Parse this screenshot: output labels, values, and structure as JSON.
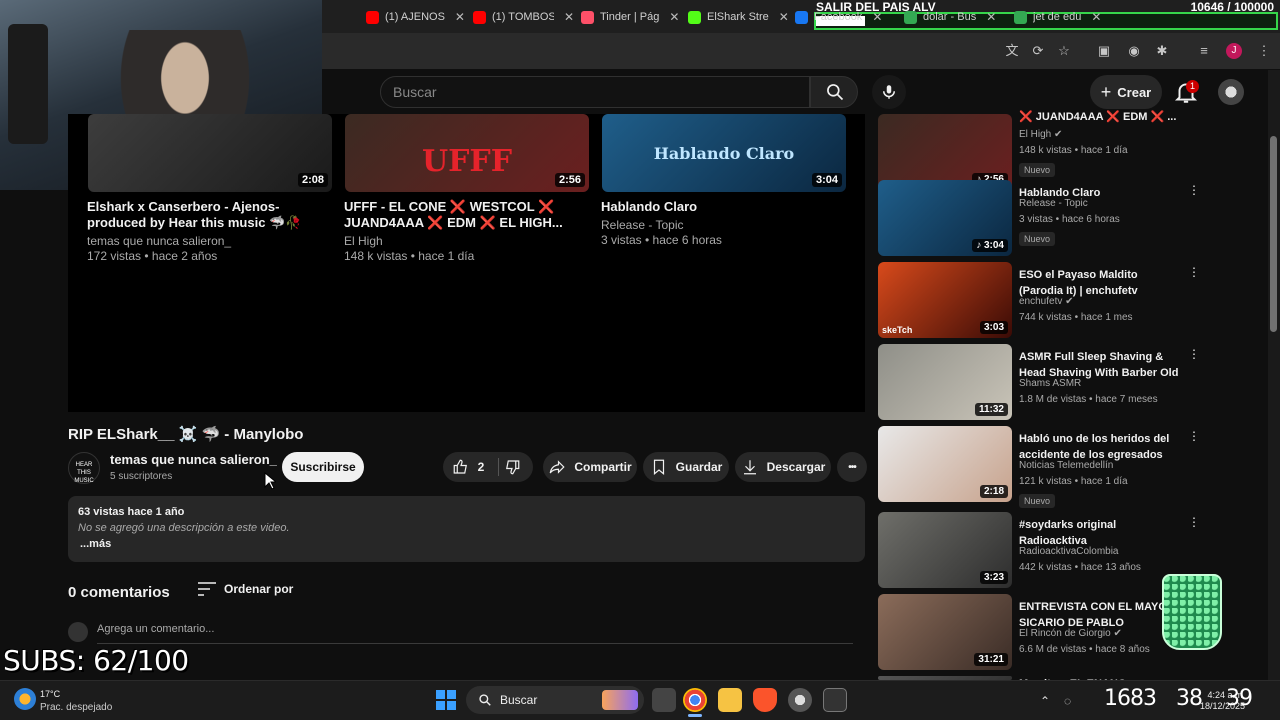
{
  "browser": {
    "tabs": [
      {
        "title": "(1) AJENOS",
        "color": "#ff0000"
      },
      {
        "title": "(1) TOMBOS",
        "color": "#ff0000"
      },
      {
        "title": "Tinder | Pág",
        "color": "#fd5068"
      },
      {
        "title": "ElShark Stre",
        "color": "#53fc18"
      },
      {
        "title": "Facebook",
        "color": "#1877f2"
      },
      {
        "title": "dolar - Bus",
        "color": "#34a853"
      },
      {
        "title": "jet de edu",
        "color": "#34a853"
      }
    ],
    "profile_initial": "J"
  },
  "stream_overlay": {
    "goal_title": "SALIR DEL PAIS ALV",
    "goal_count": "10646 / 100000",
    "goal_progress": 0.106,
    "subs_goal": "SUBS: 62/100"
  },
  "youtube_header": {
    "search_placeholder": "Buscar",
    "create_label": "Crear",
    "notification_count": "1"
  },
  "end_screen": [
    {
      "title": "Elshark x Canserbero - Ajenos- produced by Hear this music 🦈🥀",
      "channel": "temas que nunca salieron_",
      "meta": "172 vistas • hace 2 años",
      "duration": "2:08",
      "colors": [
        "#3d3d3d",
        "#1a1a1a"
      ]
    },
    {
      "title": "UFFF - EL CONE ❌ WESTCOL ❌ JUAND4AAA ❌ EDM ❌ EL HIGH...",
      "channel": "El High",
      "meta": "148 k vistas • hace 1 día",
      "duration": "2:56",
      "thumb_text": "UFFF",
      "colors": [
        "#3b2a22",
        "#6b1f1f"
      ]
    },
    {
      "title": "Hablando Claro",
      "channel": "Release - Topic",
      "meta": "3 vistas • hace 6 horas",
      "duration": "3:04",
      "thumb_text": "Hablando Claro",
      "colors": [
        "#1f5e8a",
        "#0b2740"
      ]
    }
  ],
  "video": {
    "title": "RIP ELShark__ ☠️ 🦈 - Manylobo",
    "channel_name": "temas que nunca salieron_",
    "channel_avatar_text": "HEAR THIS MUSIC",
    "subscribers": "5 suscriptores",
    "subscribe_label": "Suscribirse",
    "likes": "2",
    "share_label": "Compartir",
    "save_label": "Guardar",
    "download_label": "Descargar",
    "more_label": "•••",
    "views_date": "63 vistas  hace 1 año",
    "description": "No se agregó una descripción a este video.",
    "more_link": "...más"
  },
  "comments": {
    "count_label": "0 comentarios",
    "sort_label": "Ordenar por",
    "input_placeholder": "Agrega un comentario..."
  },
  "sidebar": [
    {
      "title": "❌ JUAND4AAA ❌ EDM ❌ ...",
      "channel": "El High ✔",
      "meta": "148 k vistas • hace 1 día",
      "badge": "Nuevo",
      "duration": "♪ 2:56",
      "colors": [
        "#3b2a22",
        "#6b1f1f"
      ]
    },
    {
      "title": "Hablando Claro",
      "channel": "Release - Topic",
      "meta": "3 vistas • hace 6 horas",
      "badge": "Nuevo",
      "duration": "♪ 3:04",
      "colors": [
        "#1f5e8a",
        "#0b2740"
      ]
    },
    {
      "title": "ESO el Payaso Maldito (Parodia It) | enchufetv",
      "channel": "enchufetv ✔",
      "meta": "744 k vistas • hace 1 mes",
      "badge": "",
      "duration": "3:03",
      "colors": [
        "#d84a1b",
        "#3a0b06"
      ],
      "overlay_text": "skeTch"
    },
    {
      "title": "ASMR Full Sleep Shaving & Head Shaving With Barber Old ...",
      "channel": "Shams ASMR",
      "meta": "1.8 M de vistas • hace 7 meses",
      "badge": "",
      "duration": "11:32",
      "colors": [
        "#8f8f88",
        "#c9c4b8"
      ]
    },
    {
      "title": "Habló uno de los heridos del accidente de los egresados de...",
      "channel": "Noticias Telemedellín",
      "meta": "121 k vistas • hace 1 día",
      "badge": "Nuevo",
      "duration": "2:18",
      "colors": [
        "#e8e8e8",
        "#c7a28c"
      ]
    },
    {
      "title": "#soydarks original Radioacktiva",
      "channel": "RadioacktivaColombia",
      "meta": "442 k vistas • hace 13 años",
      "badge": "",
      "duration": "3:23",
      "colors": [
        "#6f6f6a",
        "#2d2d2d"
      ]
    },
    {
      "title": "ENTREVISTA CON EL MAYOR SICARIO DE PABLO ESCOBAR",
      "channel": "El Rincón de Giorgio ✔",
      "meta": "6.6 M de vistas • hace 8 años",
      "badge": "",
      "duration": "31:21",
      "colors": [
        "#8b6c5a",
        "#3a2c26"
      ]
    },
    {
      "title": "Mamitas: EL ENANO TRAQUETO...",
      "channel": "",
      "meta": "",
      "badge": "",
      "duration": "",
      "colors": [
        "#555",
        "#333"
      ]
    }
  ],
  "taskbar": {
    "temperature": "17°C",
    "weather": "Prac. despejado",
    "search_label": "Buscar",
    "time": "4:24 a.m.",
    "date": "18/12/2025",
    "overlay_left": "1683",
    "overlay_mid": "38",
    "overlay_right": "39"
  }
}
